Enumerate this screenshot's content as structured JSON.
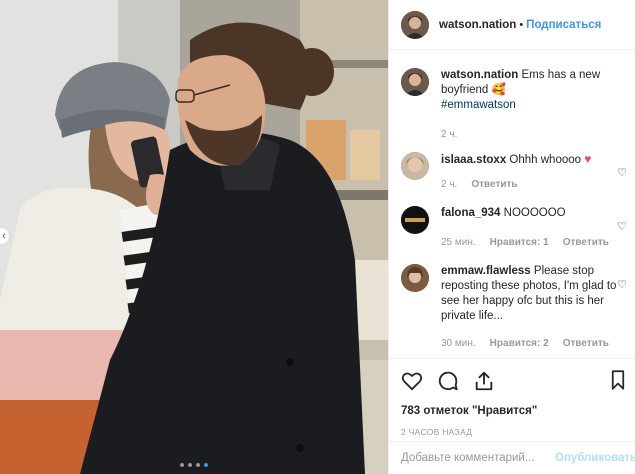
{
  "header": {
    "username": "watson.nation",
    "separator": "•",
    "follow_label": "Подписаться"
  },
  "caption": {
    "username": "watson.nation",
    "text": "Ems has a new boyfriend",
    "emoji": "🥰",
    "hashtag": "#emmawatson",
    "time": "2 ч."
  },
  "comments": [
    {
      "username": "islaaa.stoxx",
      "text": "Ohhh whoooo",
      "emoji": "♥",
      "time": "2 ч.",
      "reply": "Ответить",
      "likes": ""
    },
    {
      "username": "falona_934",
      "text": "NOOOOOO",
      "time": "25 мин.",
      "likes": "Нравится: 1",
      "reply": "Ответить"
    },
    {
      "username": "emmaw.flawless",
      "text": "Please stop reposting these photos, I'm glad to see her happy ofc but this is her private life...",
      "time": "30 мин.",
      "likes": "Нравится: 2",
      "reply": "Ответить"
    }
  ],
  "actions": {
    "likes_label": "783 отметок \"Нравится\"",
    "time_label": "2 ЧАСОВ НАЗАД"
  },
  "add_comment": {
    "placeholder": "Добавьте комментарий...",
    "post_label": "Опубликовать"
  },
  "carousel": {
    "dots": 4,
    "active": 3
  }
}
